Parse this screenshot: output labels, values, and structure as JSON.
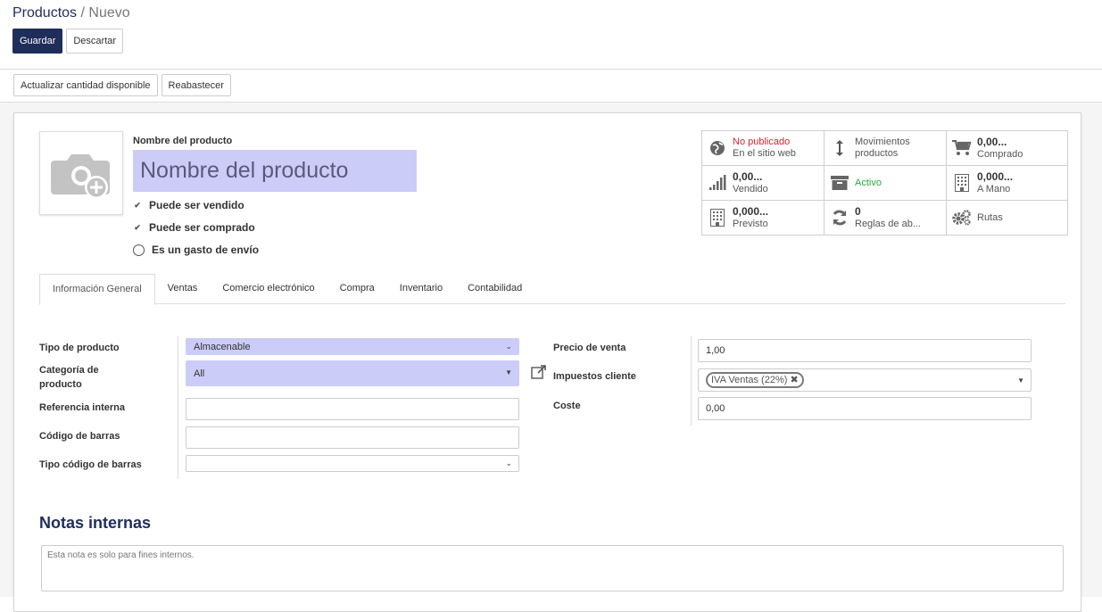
{
  "breadcrumb": {
    "parent": "Productos",
    "separator": "/",
    "current": "Nuevo"
  },
  "actions": {
    "save": "Guardar",
    "discard": "Descartar"
  },
  "statusbar": {
    "update_qty": "Actualizar cantidad disponible",
    "replenish": "Reabastecer"
  },
  "product": {
    "name_label": "Nombre del producto",
    "name_placeholder": "Nombre del producto",
    "can_be_sold": "Puede ser vendido",
    "can_be_purchased": "Puede ser comprado",
    "is_shipping": "Es un gasto de envío"
  },
  "smart_buttons": {
    "website": {
      "line1": "No publicado",
      "line2": "En el sitio web",
      "color": "#d9232d"
    },
    "moves": {
      "line1": "Movimientos",
      "line2": "productos"
    },
    "purchased": {
      "value": "0,00...",
      "label": "Comprado"
    },
    "sold": {
      "value": "0,00...",
      "label": "Vendido"
    },
    "active": {
      "label": "Activo",
      "color": "#28a745"
    },
    "on_hand": {
      "value": "0,000...",
      "label": "A Mano"
    },
    "forecast": {
      "value": "0,000...",
      "label": "Previsto"
    },
    "reorder": {
      "value": "0",
      "label": "Reglas de ab..."
    },
    "routes": {
      "label": "Rutas"
    }
  },
  "tabs": [
    "Información General",
    "Ventas",
    "Comercio electrónico",
    "Compra",
    "Inventario",
    "Contabilidad"
  ],
  "general": {
    "product_type_label": "Tipo de producto",
    "product_type_value": "Almacenable",
    "category_label_1": "Categoría de",
    "category_label_2": "producto",
    "category_value": "All",
    "internal_ref_label": "Referencia interna",
    "barcode_label": "Código de barras",
    "barcode_type_label": "Tipo código de barras",
    "sale_price_label": "Precio de venta",
    "sale_price_value": "1,00",
    "customer_taxes_label": "Impuestos cliente",
    "customer_taxes_tag": "IVA Ventas (22%)",
    "cost_label": "Coste",
    "cost_value": "0,00"
  },
  "notes": {
    "title": "Notas internas",
    "placeholder": "Esta nota es solo para fines internos."
  },
  "colors": {
    "brand": "#1f2d5a",
    "required_field": "#ccccf9"
  }
}
